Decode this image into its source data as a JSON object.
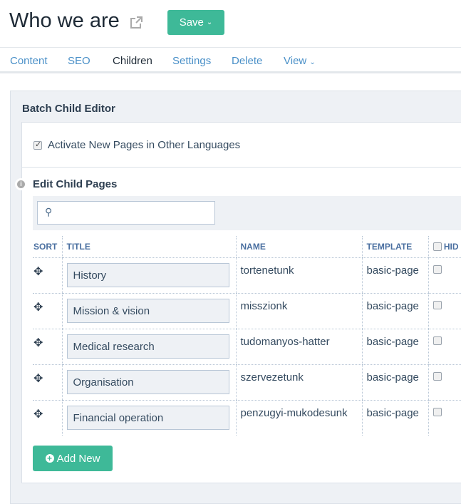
{
  "header": {
    "title": "Who we are",
    "save_label": "Save",
    "external_icon": "external-link-icon"
  },
  "tabs": [
    {
      "label": "Content"
    },
    {
      "label": "SEO"
    },
    {
      "label": "Children",
      "active": true
    },
    {
      "label": "Settings"
    },
    {
      "label": "Delete"
    },
    {
      "label": "View"
    }
  ],
  "panel": {
    "title": "Batch Child Editor",
    "activate_label": "Activate New Pages in Other Languages",
    "activate_checked": true,
    "section_title": "Edit Child Pages",
    "search_placeholder": "",
    "add_label": "Add New"
  },
  "table": {
    "headers": [
      "SORT",
      "TITLE",
      "NAME",
      "TEMPLATE",
      "HID"
    ],
    "rows": [
      {
        "title": "History",
        "name": "tortenetunk",
        "template": "basic-page",
        "hidden": false
      },
      {
        "title": "Mission & vision",
        "name": "misszionk",
        "template": "basic-page",
        "hidden": false
      },
      {
        "title": "Medical research",
        "name": "tudomanyos-hatter",
        "template": "basic-page",
        "hidden": false
      },
      {
        "title": "Organisation",
        "name": "szervezetunk",
        "template": "basic-page",
        "hidden": false
      },
      {
        "title": "Financial operation",
        "name": "penzugyi-mukodesunk",
        "template": "basic-page",
        "hidden": false
      }
    ]
  },
  "colors": {
    "accent": "#3eb998",
    "link": "#4a90c8",
    "panel_bg": "#eef1f5"
  }
}
